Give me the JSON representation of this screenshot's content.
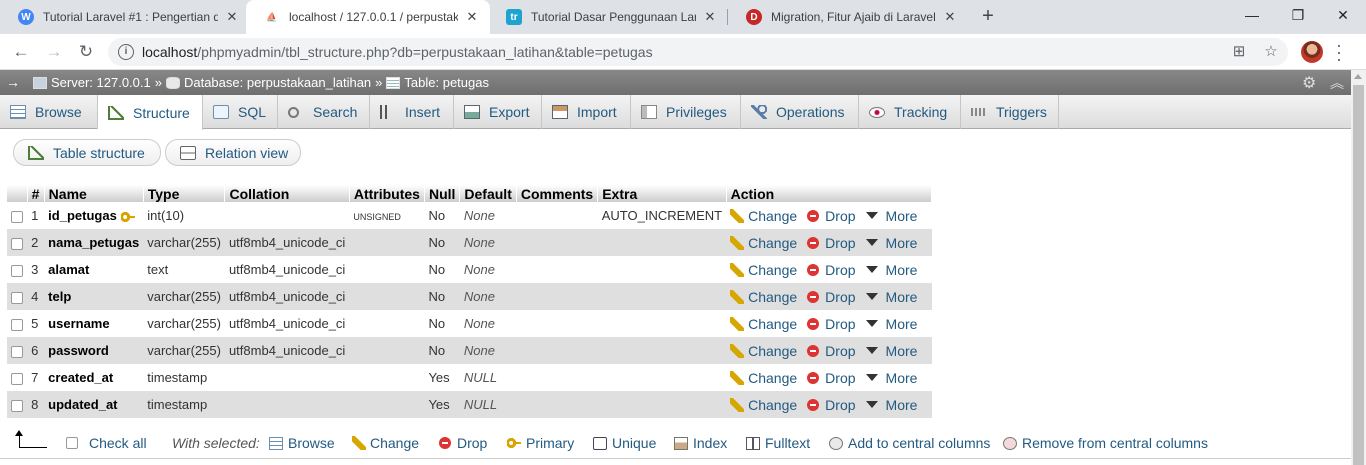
{
  "browser": {
    "tabs": [
      {
        "title": "Tutorial Laravel #1 : Pengertian d",
        "favicon": "W",
        "favicon_color": "#4285f4"
      },
      {
        "title": "localhost / 127.0.0.1 / perpustaka",
        "favicon": "pma",
        "favicon_color": "#f29111"
      },
      {
        "title": "Tutorial Dasar Penggunaan Larav",
        "favicon": "tr",
        "favicon_color": "#1ea3d1"
      },
      {
        "title": "Migration, Fitur Ajaib di Laravel -",
        "favicon": "D",
        "favicon_color": "#c62828"
      }
    ],
    "new_tab": "+",
    "window": {
      "minimize": "—",
      "maximize": "❐",
      "close": "✕"
    },
    "url_host": "localhost",
    "url_rest": "/phpmyadmin/tbl_structure.php?db=perpustakaan_latihan&table=petugas"
  },
  "pma": {
    "breadcrumb": {
      "server": "Server: 127.0.0.1",
      "database": "Database: perpustakaan_latihan",
      "table": "Table: petugas",
      "separator": "»"
    },
    "tabs": [
      {
        "label": "Browse",
        "icon": "browse-icon"
      },
      {
        "label": "Structure",
        "icon": "structure-icon"
      },
      {
        "label": "SQL",
        "icon": "sql-icon"
      },
      {
        "label": "Search",
        "icon": "search-icon"
      },
      {
        "label": "Insert",
        "icon": "insert-icon"
      },
      {
        "label": "Export",
        "icon": "export-icon"
      },
      {
        "label": "Import",
        "icon": "import-icon"
      },
      {
        "label": "Privileges",
        "icon": "privileges-icon"
      },
      {
        "label": "Operations",
        "icon": "operations-icon"
      },
      {
        "label": "Tracking",
        "icon": "tracking-icon"
      },
      {
        "label": "Triggers",
        "icon": "triggers-icon"
      }
    ],
    "active_tab": "Structure",
    "subtabs": {
      "table_structure": "Table structure",
      "relation_view": "Relation view"
    },
    "columns": [
      "#",
      "Name",
      "Type",
      "Collation",
      "Attributes",
      "Null",
      "Default",
      "Comments",
      "Extra",
      "Action"
    ],
    "rows": [
      {
        "num": "1",
        "name": "id_petugas",
        "type": "int(10)",
        "collation": "",
        "attributes": "UNSIGNED",
        "null": "No",
        "default": "None",
        "comments": "",
        "extra": "AUTO_INCREMENT",
        "primary_key": true
      },
      {
        "num": "2",
        "name": "nama_petugas",
        "type": "varchar(255)",
        "collation": "utf8mb4_unicode_ci",
        "attributes": "",
        "null": "No",
        "default": "None",
        "comments": "",
        "extra": ""
      },
      {
        "num": "3",
        "name": "alamat",
        "type": "text",
        "collation": "utf8mb4_unicode_ci",
        "attributes": "",
        "null": "No",
        "default": "None",
        "comments": "",
        "extra": ""
      },
      {
        "num": "4",
        "name": "telp",
        "type": "varchar(255)",
        "collation": "utf8mb4_unicode_ci",
        "attributes": "",
        "null": "No",
        "default": "None",
        "comments": "",
        "extra": ""
      },
      {
        "num": "5",
        "name": "username",
        "type": "varchar(255)",
        "collation": "utf8mb4_unicode_ci",
        "attributes": "",
        "null": "No",
        "default": "None",
        "comments": "",
        "extra": ""
      },
      {
        "num": "6",
        "name": "password",
        "type": "varchar(255)",
        "collation": "utf8mb4_unicode_ci",
        "attributes": "",
        "null": "No",
        "default": "None",
        "comments": "",
        "extra": ""
      },
      {
        "num": "7",
        "name": "created_at",
        "type": "timestamp",
        "collation": "",
        "attributes": "",
        "null": "Yes",
        "default": "NULL",
        "comments": "",
        "extra": ""
      },
      {
        "num": "8",
        "name": "updated_at",
        "type": "timestamp",
        "collation": "",
        "attributes": "",
        "null": "Yes",
        "default": "NULL",
        "comments": "",
        "extra": ""
      }
    ],
    "row_actions": {
      "change": "Change",
      "drop": "Drop",
      "more": "More"
    },
    "bottom": {
      "check_all": "Check all",
      "with_selected": "With selected:",
      "browse": "Browse",
      "change": "Change",
      "drop": "Drop",
      "primary": "Primary",
      "unique": "Unique",
      "index": "Index",
      "fulltext": "Fulltext",
      "add_central": "Add to central columns",
      "remove_central": "Remove from central columns"
    }
  }
}
